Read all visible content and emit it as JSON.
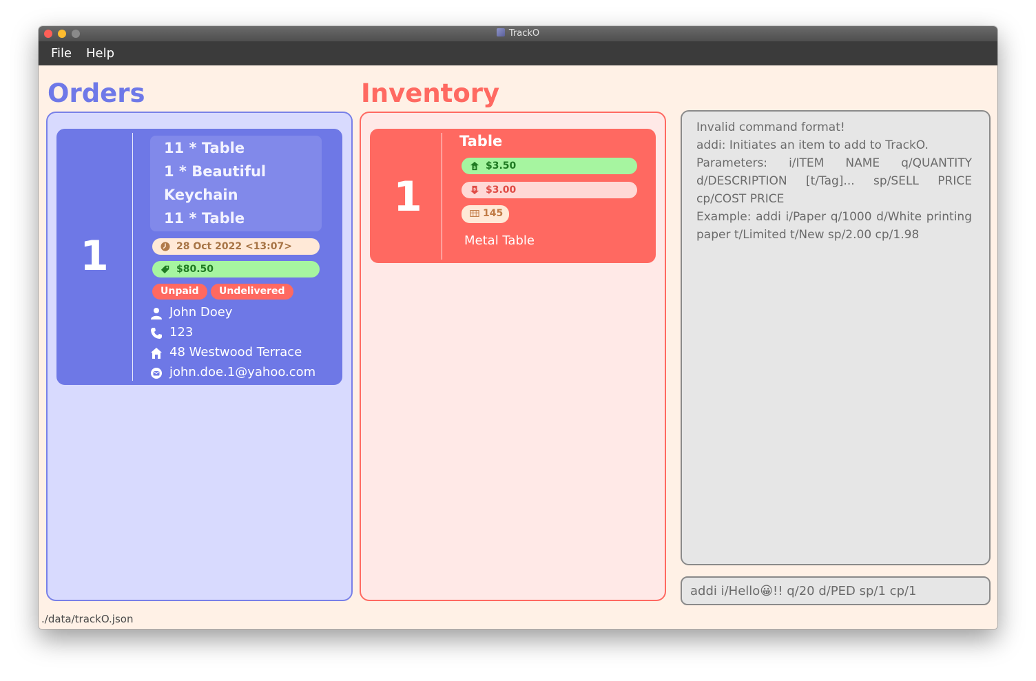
{
  "window": {
    "title": "TrackO"
  },
  "menu": {
    "file": "File",
    "help": "Help"
  },
  "orders": {
    "heading": "Orders",
    "cards": [
      {
        "index": "1",
        "items": [
          "11 * Table",
          "1 * Beautiful",
          "Keychain",
          "11 * Table"
        ],
        "date": "28 Oct 2022 <13:07>",
        "price": "$80.50",
        "tags": {
          "paid": "Unpaid",
          "delivered": "Undelivered"
        },
        "name": "John Doey",
        "phone": "123",
        "address": "48 Westwood Terrace",
        "email": "john.doe.1@yahoo.com"
      }
    ]
  },
  "inventory": {
    "heading": "Inventory",
    "cards": [
      {
        "index": "1",
        "name": "Table",
        "sell_price": "$3.50",
        "cost_price": "$3.00",
        "quantity": "145",
        "description": "Metal Table"
      }
    ]
  },
  "result": {
    "text": "Invalid command format!\naddi: Initiates an item to add to TrackO.\nParameters: i/ITEM NAME q/QUANTITY d/DESCRIPTION [t/Tag]... sp/SELL PRICE cp/COST PRICE\nExample: addi i/Paper q/1000 d/White printing paper t/Limited t/New sp/2.00 cp/1.98"
  },
  "command": {
    "value": "addi i/Hello😀!! q/20 d/PED sp/1 cp/1"
  },
  "status_bar": {
    "path": "./data/trackO.json"
  },
  "colors": {
    "orders_accent": "#6e78e8",
    "inventory_accent": "#ff6961",
    "pill_green": "#a6f5a0",
    "tag_red": "#ff6961"
  },
  "icons": {
    "date": "clock-icon",
    "price": "price-tag-icon",
    "person": "person-icon",
    "phone": "phone-icon",
    "address": "home-icon",
    "email": "email-icon",
    "sell": "sell-price-icon",
    "cost": "cost-price-icon",
    "quantity": "inventory-icon"
  }
}
